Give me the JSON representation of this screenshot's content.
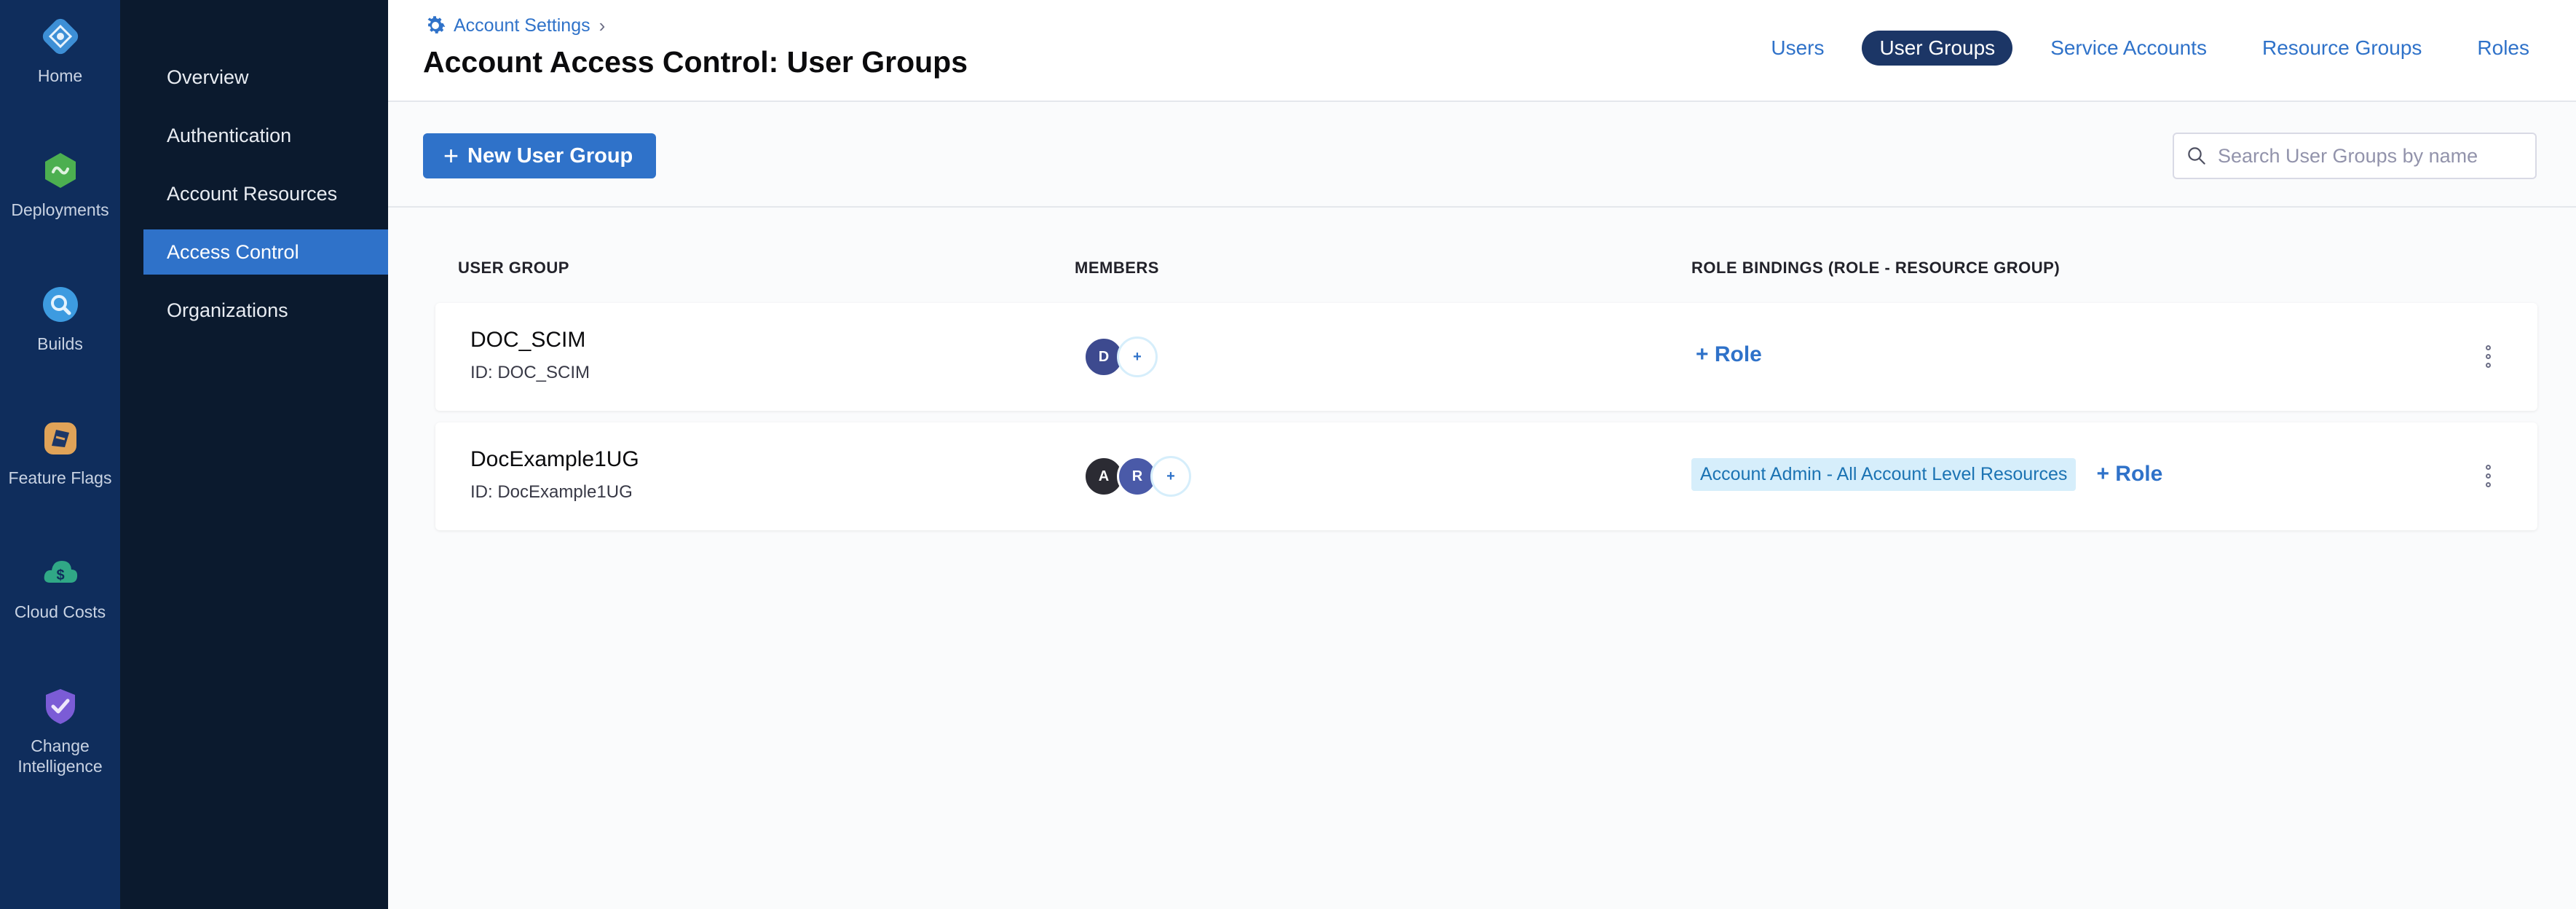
{
  "rail": {
    "items": [
      {
        "label": "Home",
        "icon": "harness-logo-icon"
      },
      {
        "label": "Deployments",
        "icon": "deployments-icon"
      },
      {
        "label": "Builds",
        "icon": "builds-icon"
      },
      {
        "label": "Feature Flags",
        "icon": "feature-flags-icon"
      },
      {
        "label": "Cloud Costs",
        "icon": "cloud-costs-icon"
      },
      {
        "label": "Change Intelligence",
        "label_line1": "Change",
        "label_line2": "Intelligence",
        "icon": "change-intelligence-icon"
      }
    ]
  },
  "subnav": {
    "items": [
      {
        "label": "Overview"
      },
      {
        "label": "Authentication"
      },
      {
        "label": "Account Resources"
      },
      {
        "label": "Access Control"
      },
      {
        "label": "Organizations"
      }
    ],
    "active_index": 3
  },
  "header": {
    "breadcrumb": "Account Settings",
    "breadcrumb_icon": "gear-icon",
    "title": "Account Access Control: User Groups",
    "tabs": [
      {
        "label": "Users"
      },
      {
        "label": "User Groups"
      },
      {
        "label": "Service Accounts"
      },
      {
        "label": "Resource Groups"
      },
      {
        "label": "Roles"
      }
    ],
    "active_tab": "User Groups"
  },
  "toolbar": {
    "new_button_label": "New User Group",
    "search_placeholder": "Search User Groups by name"
  },
  "table": {
    "columns": {
      "user_group": "USER GROUP",
      "members": "MEMBERS",
      "role_bindings": "ROLE BINDINGS (ROLE - RESOURCE GROUP)"
    },
    "rows": [
      {
        "name": "DOC_SCIM",
        "id_text": "ID: DOC_SCIM",
        "members": [
          {
            "initial": "D",
            "color": "#3d4a8f"
          }
        ],
        "add_member": "+",
        "role_badges": [],
        "add_role": "+ Role"
      },
      {
        "name": "DocExample1UG",
        "id_text": "ID: DocExample1UG",
        "members": [
          {
            "initial": "A",
            "color": "#2b2b33"
          },
          {
            "initial": "R",
            "color": "#4a5aa8"
          }
        ],
        "add_member": "+",
        "role_badges": [
          "Account Admin - All Account Level Resources"
        ],
        "add_role": "+ Role"
      }
    ]
  },
  "colors": {
    "rail_bg": "#0f2d5c",
    "subnav_bg": "#0b1a2e",
    "accent": "#2f72c9",
    "active_tab_bg": "#1c3666"
  }
}
